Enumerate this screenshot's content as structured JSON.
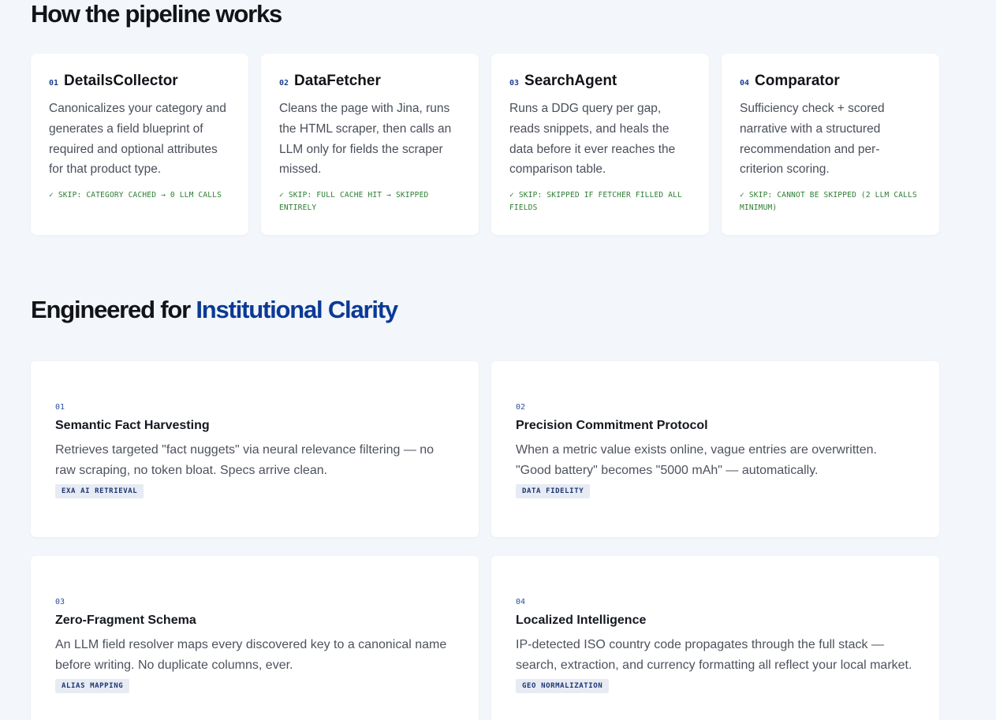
{
  "pipeline": {
    "heading": "How the pipeline works",
    "steps": [
      {
        "num": "01",
        "title": "DetailsCollector",
        "desc": "Canonicalizes your category and generates a field blueprint of required and optional attributes for that product type.",
        "skip": "✓ SKIP: CATEGORY CACHED → 0 LLM CALLS"
      },
      {
        "num": "02",
        "title": "DataFetcher",
        "desc": "Cleans the page with Jina, runs the HTML scraper, then calls an LLM only for fields the scraper missed.",
        "skip": "✓ SKIP: FULL CACHE HIT → SKIPPED ENTIRELY"
      },
      {
        "num": "03",
        "title": "SearchAgent",
        "desc": "Runs a DDG query per gap, reads snippets, and heals the data before it ever reaches the comparison table.",
        "skip": "✓ SKIP: SKIPPED IF FETCHER FILLED ALL FIELDS"
      },
      {
        "num": "04",
        "title": "Comparator",
        "desc": "Sufficiency check + scored narrative with a structured recommendation and per-criterion scoring.",
        "skip": "✓ SKIP: CANNOT BE SKIPPED (2 LLM CALLS MINIMUM)"
      }
    ]
  },
  "engineered": {
    "heading_prefix": "Engineered for",
    "heading_accent": "Institutional Clarity",
    "features": [
      {
        "num": "01",
        "title": "Semantic Fact Harvesting",
        "desc": "Retrieves targeted \"fact nuggets\" via neural relevance filtering — no raw scraping, no token bloat. Specs arrive clean.",
        "tag": "EXA AI RETRIEVAL"
      },
      {
        "num": "02",
        "title": "Precision Commitment Protocol",
        "desc": "When a metric value exists online, vague entries are overwritten. \"Good battery\" becomes \"5000 mAh\" — automatically.",
        "tag": "DATA FIDELITY"
      },
      {
        "num": "03",
        "title": "Zero-Fragment Schema",
        "desc": "An LLM field resolver maps every discovered key to a canonical name before writing. No duplicate columns, ever.",
        "tag": "ALIAS MAPPING"
      },
      {
        "num": "04",
        "title": "Localized Intelligence",
        "desc": "IP-detected ISO country code propagates through the full stack — search, extraction, and currency formatting all reflect your local market.",
        "tag": "GEO NORMALIZATION"
      }
    ]
  }
}
